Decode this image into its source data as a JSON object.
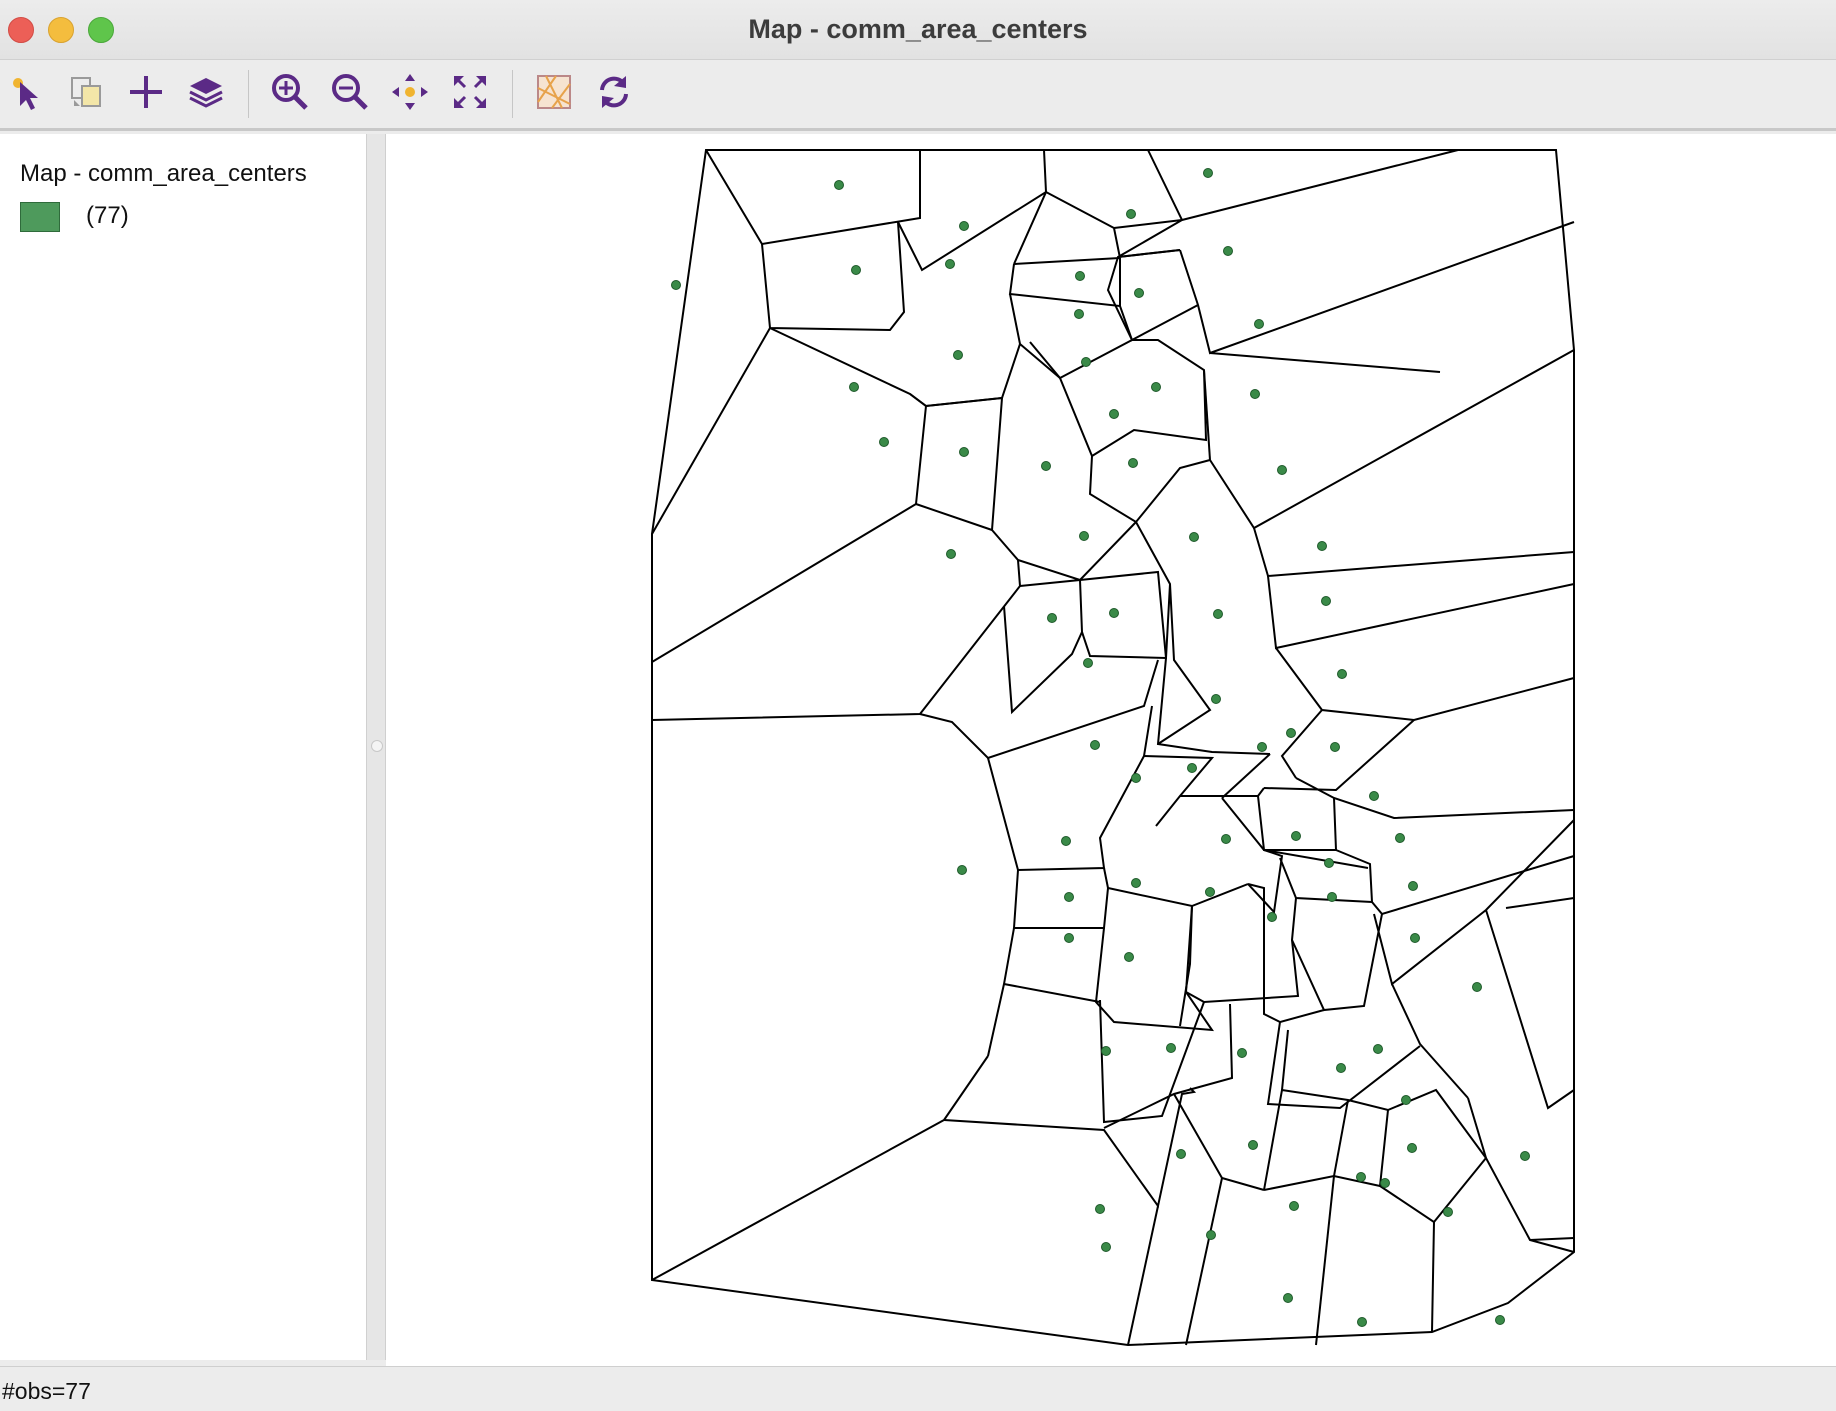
{
  "window": {
    "title": "Map - comm_area_centers"
  },
  "toolbar": {
    "buttons": [
      {
        "icon": "select-pointer-icon",
        "label": "Select"
      },
      {
        "icon": "copy-image-icon",
        "label": "Copy"
      },
      {
        "icon": "add-layer-icon",
        "label": "Add Layer"
      },
      {
        "icon": "layers-icon",
        "label": "Layers"
      },
      {
        "icon": "zoom-in-icon",
        "label": "Zoom In"
      },
      {
        "icon": "zoom-out-icon",
        "label": "Zoom Out"
      },
      {
        "icon": "pan-icon",
        "label": "Pan"
      },
      {
        "icon": "full-extent-icon",
        "label": "Full Extent"
      },
      {
        "icon": "basemap-icon",
        "label": "Basemap"
      },
      {
        "icon": "refresh-icon",
        "label": "Refresh"
      }
    ]
  },
  "legend": {
    "title": "Map - comm_area_centers",
    "items": [
      {
        "label": "(77)",
        "color": "#4e9a5c"
      }
    ]
  },
  "map": {
    "point_color": "#3a8a48",
    "polygon_fill": "#ffffff",
    "polygon_stroke": "#000000"
  },
  "status": {
    "text": "#obs=77"
  }
}
